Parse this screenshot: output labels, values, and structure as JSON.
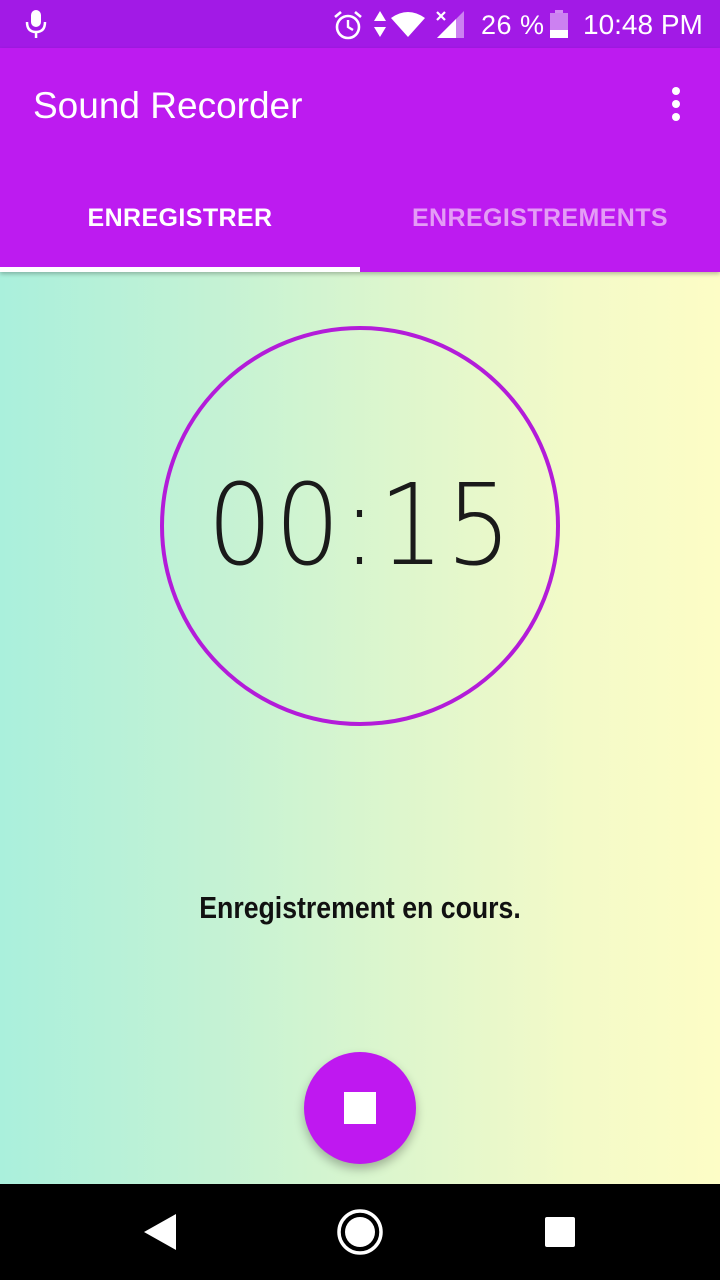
{
  "status_bar": {
    "battery_percent": "26 %",
    "time": "10:48 PM",
    "icons": [
      "mic-icon",
      "alarm-icon",
      "data-arrows-icon",
      "wifi-icon",
      "signal-icon",
      "battery-icon"
    ]
  },
  "app_bar": {
    "title": "Sound Recorder",
    "menu_icon": "more-vert-icon"
  },
  "tabs": [
    {
      "label": "ENREGISTRER",
      "selected": true
    },
    {
      "label": "ENREGISTREMENTS",
      "selected": false
    }
  ],
  "recorder": {
    "elapsed": "00:15",
    "status_message": "Enregistrement en cours.",
    "stop_icon": "stop-icon"
  },
  "nav_bar": {
    "icons": [
      "back-icon",
      "home-icon",
      "recents-icon"
    ]
  },
  "colors": {
    "status_bar": "#a21ae6",
    "app_bar": "#bd1bf0",
    "accent": "#bf18f0",
    "inactive_tab": "#e49cf6",
    "ring": "#b31cd9"
  }
}
